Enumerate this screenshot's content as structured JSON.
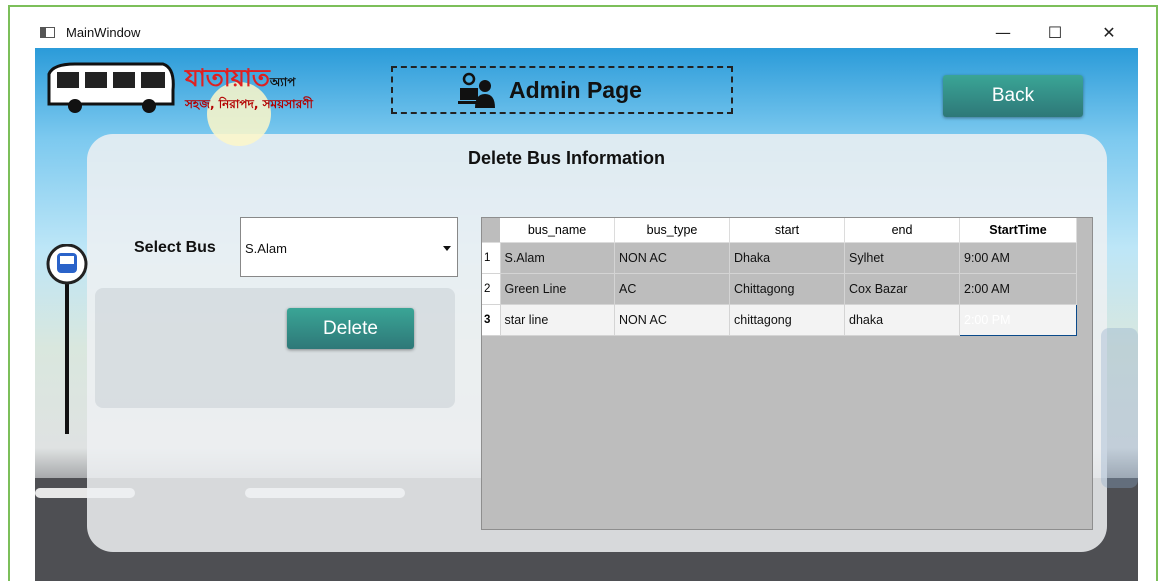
{
  "window": {
    "title": "MainWindow",
    "minimize": "—",
    "maximize": "☐",
    "close": "✕"
  },
  "header": {
    "app_name": "যাতায়াত",
    "app_suffix": "অ্যাপ",
    "tagline": "সহজ, নিরাপদ, সময়সারণী",
    "page_title": "Admin Page",
    "back_label": "Back"
  },
  "main": {
    "heading": "Delete Bus Information",
    "select_label": "Select Bus",
    "selected_bus": "S.Alam",
    "delete_label": "Delete"
  },
  "table": {
    "columns": [
      "bus_name",
      "bus_type",
      "start",
      "end",
      "StartTime"
    ],
    "rows": [
      {
        "index": "1",
        "bus_name": "S.Alam",
        "bus_type": "NON AC",
        "start": "Dhaka",
        "end": "Sylhet",
        "start_time": "9:00 AM"
      },
      {
        "index": "2",
        "bus_name": "Green Line",
        "bus_type": "AC",
        "start": "Chittagong",
        "end": "Cox Bazar",
        "start_time": "2:00 AM"
      },
      {
        "index": "3",
        "bus_name": "star line",
        "bus_type": "NON AC",
        "start": "chittagong",
        "end": "dhaka",
        "start_time": "2:00 PM"
      }
    ]
  },
  "colors": {
    "accent": "#2e8b84",
    "selection": "#0078d7",
    "window_border": "#7cbf5a"
  }
}
